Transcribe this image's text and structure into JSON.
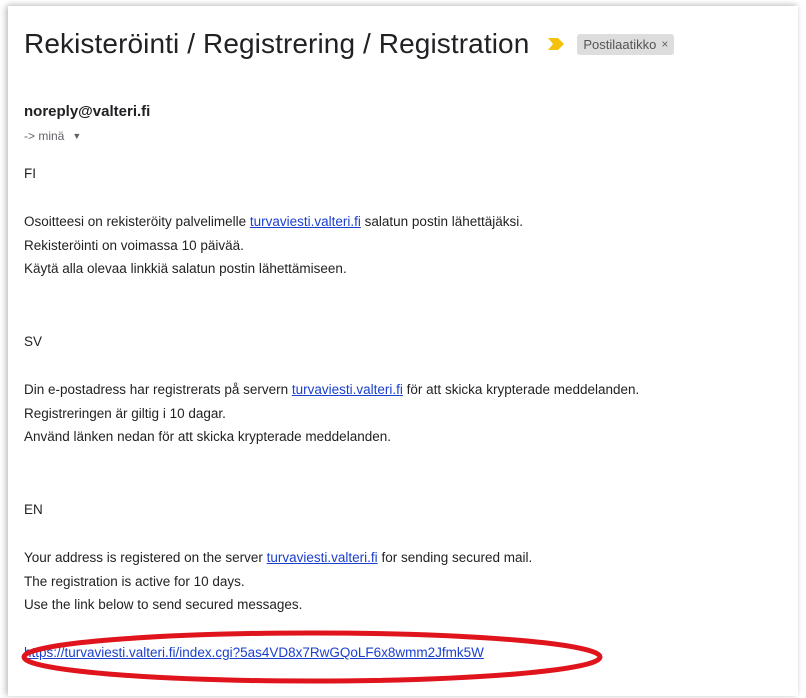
{
  "email": {
    "subject": "Rekisteröinti / Registrering / Registration",
    "label_chip": "Postilaatikko",
    "label_close": "×",
    "sender": "noreply@valteri.fi",
    "recipient": "-> minä",
    "recipient_caret": "▼"
  },
  "body": {
    "fi": {
      "heading": "FI",
      "line1_pre": "Osoitteesi on rekisteröity palvelimelle ",
      "line1_link": "turvaviesti.valteri.fi",
      "line1_post": " salatun postin lähettäjäksi.",
      "line2": "Rekisteröinti on voimassa 10 päivää.",
      "line3": "Käytä alla olevaa linkkiä salatun postin lähettämiseen."
    },
    "sv": {
      "heading": "SV",
      "line1_pre": "Din e-postadress har registrerats på servern ",
      "line1_link": "turvaviesti.valteri.fi",
      "line1_post": " för att skicka krypterade meddelanden.",
      "line2": "Registreringen är giltig i 10 dagar.",
      "line3": "Använd länken nedan för att skicka krypterade meddelanden."
    },
    "en": {
      "heading": "EN",
      "line1_pre": "Your address is registered on the server ",
      "line1_link": "turvaviesti.valteri.fi",
      "line1_post": " for sending secured mail.",
      "line2": "The registration is active for 10 days.",
      "line3": "Use the link below to send secured messages."
    },
    "registration_url": "https://turvaviesti.valteri.fi/index.cgi?5as4VD8x7RwGQoLF6x8wmm2Jfmk5W"
  },
  "colors": {
    "link": "#1a3fcf",
    "important_marker": "#f4c20d",
    "highlight_ellipse": "#e0141c"
  }
}
